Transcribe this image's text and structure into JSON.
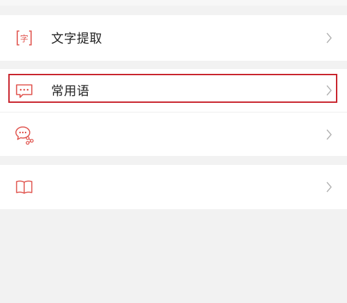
{
  "menu": {
    "items": [
      {
        "label": "文字提取",
        "icon": "text-extract-icon"
      },
      {
        "label": "常用语",
        "icon": "chat-bubble-icon"
      },
      {
        "label": "",
        "icon": "chat-share-icon"
      },
      {
        "label": "",
        "icon": "book-icon"
      }
    ]
  },
  "colors": {
    "accent": "#e0554f",
    "highlight_border": "#c8232c",
    "background": "#f2f2f2",
    "row_background": "#ffffff",
    "chevron": "#b0b0b0"
  }
}
